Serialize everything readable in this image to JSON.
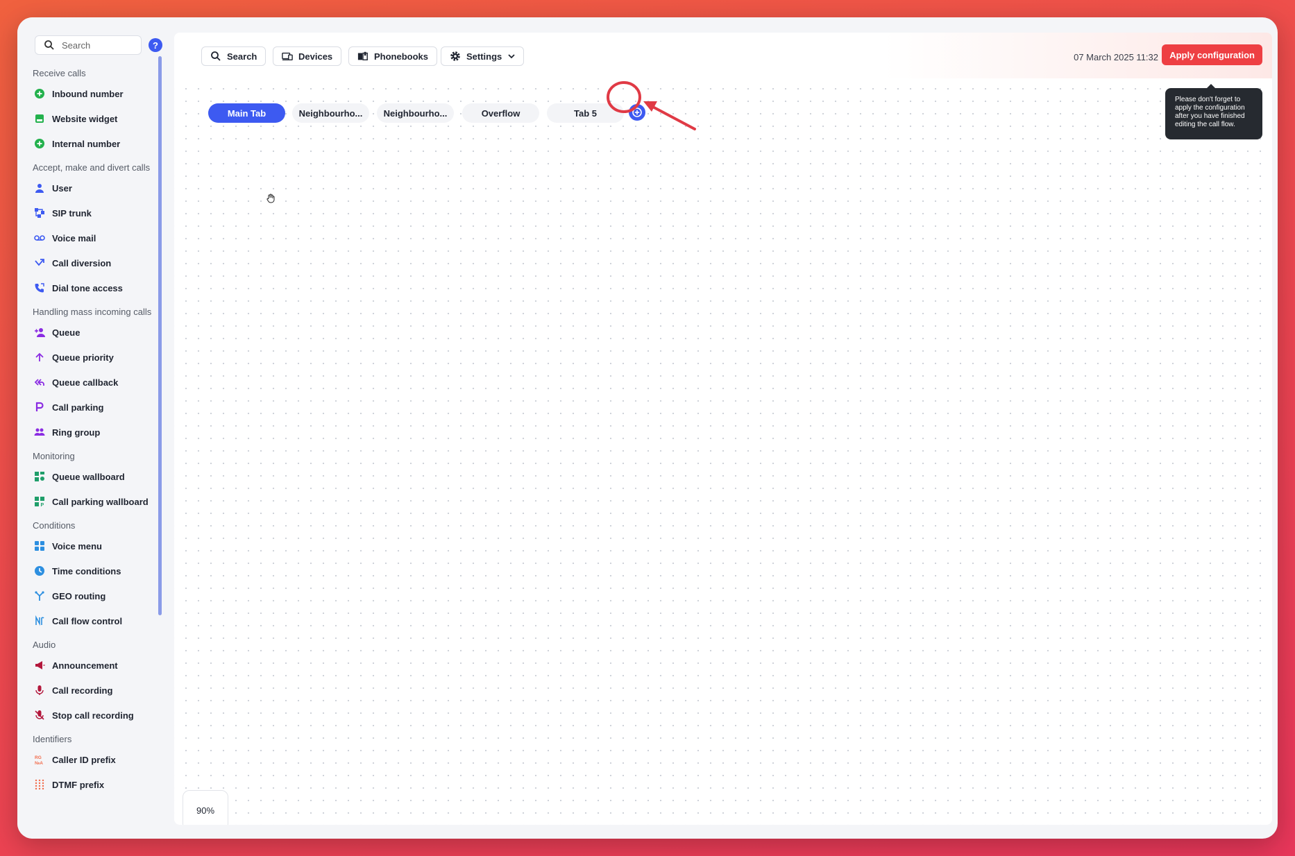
{
  "sidebar": {
    "search_placeholder": "Search",
    "help_label": "?",
    "sections": [
      {
        "title": "Receive calls",
        "items": [
          {
            "label": "Inbound number",
            "icon": "plus-circle-icon",
            "color": "#23b14d"
          },
          {
            "label": "Website widget",
            "icon": "widget-icon",
            "color": "#23b14d"
          },
          {
            "label": "Internal number",
            "icon": "plus-circle-icon",
            "color": "#23b14d"
          }
        ]
      },
      {
        "title": "Accept, make and divert calls",
        "items": [
          {
            "label": "User",
            "icon": "user-icon",
            "color": "#3d5af1"
          },
          {
            "label": "SIP trunk",
            "icon": "sip-trunk-icon",
            "color": "#3d5af1"
          },
          {
            "label": "Voice mail",
            "icon": "voicemail-icon",
            "color": "#3d5af1"
          },
          {
            "label": "Call diversion",
            "icon": "diversion-arrow-icon",
            "color": "#3d5af1"
          },
          {
            "label": "Dial tone access",
            "icon": "phone-icon",
            "color": "#3d5af1"
          }
        ]
      },
      {
        "title": "Handling mass incoming calls",
        "items": [
          {
            "label": "Queue",
            "icon": "queue-user-icon",
            "color": "#8a2be2"
          },
          {
            "label": "Queue priority",
            "icon": "arrow-up-icon",
            "color": "#8a2be2"
          },
          {
            "label": "Queue callback",
            "icon": "callback-icon",
            "color": "#8a2be2"
          },
          {
            "label": "Call parking",
            "icon": "parking-icon",
            "color": "#8a2be2"
          },
          {
            "label": "Ring group",
            "icon": "group-icon",
            "color": "#8a2be2"
          }
        ]
      },
      {
        "title": "Monitoring",
        "items": [
          {
            "label": "Queue wallboard",
            "icon": "wallboard-icon",
            "color": "#1f9e6a"
          },
          {
            "label": "Call parking wallboard",
            "icon": "parking-wallboard-icon",
            "color": "#1f9e6a"
          }
        ]
      },
      {
        "title": "Conditions",
        "items": [
          {
            "label": "Voice menu",
            "icon": "grid-icon",
            "color": "#2d8fe0"
          },
          {
            "label": "Time conditions",
            "icon": "clock-icon",
            "color": "#2d8fe0"
          },
          {
            "label": "GEO routing",
            "icon": "fork-icon",
            "color": "#2d8fe0"
          },
          {
            "label": "Call flow control",
            "icon": "flow-icon",
            "color": "#2d8fe0"
          }
        ]
      },
      {
        "title": "Audio",
        "items": [
          {
            "label": "Announcement",
            "icon": "megaphone-icon",
            "color": "#b3173c"
          },
          {
            "label": "Call recording",
            "icon": "microphone-icon",
            "color": "#b3173c"
          },
          {
            "label": "Stop call recording",
            "icon": "microphone-off-icon",
            "color": "#b3173c"
          }
        ]
      },
      {
        "title": "Identifiers",
        "items": [
          {
            "label": "Caller ID prefix",
            "icon": "caller-id-icon",
            "color": "#f26b4a"
          },
          {
            "label": "DTMF prefix",
            "icon": "dtmf-icon",
            "color": "#f26b4a"
          }
        ]
      }
    ]
  },
  "toolbar": {
    "search_label": "Search",
    "devices_label": "Devices",
    "phonebooks_label": "Phonebooks",
    "settings_label": "Settings",
    "date": "07 March 2025 11:32",
    "apply_label": "Apply configuration",
    "tooltip": "Please don't forget to apply the configuration after you have finished editing the call flow."
  },
  "tabs": [
    {
      "label": "Main Tab",
      "active": true
    },
    {
      "label": "Neighbourho...",
      "active": false
    },
    {
      "label": "Neighbourho...",
      "active": false
    },
    {
      "label": "Overflow",
      "active": false
    },
    {
      "label": "Tab 5",
      "active": false
    }
  ],
  "zoom": "90%",
  "colors": {
    "accent": "#3d5af1",
    "apply": "#ee3f43",
    "annotation": "#e03a45"
  }
}
